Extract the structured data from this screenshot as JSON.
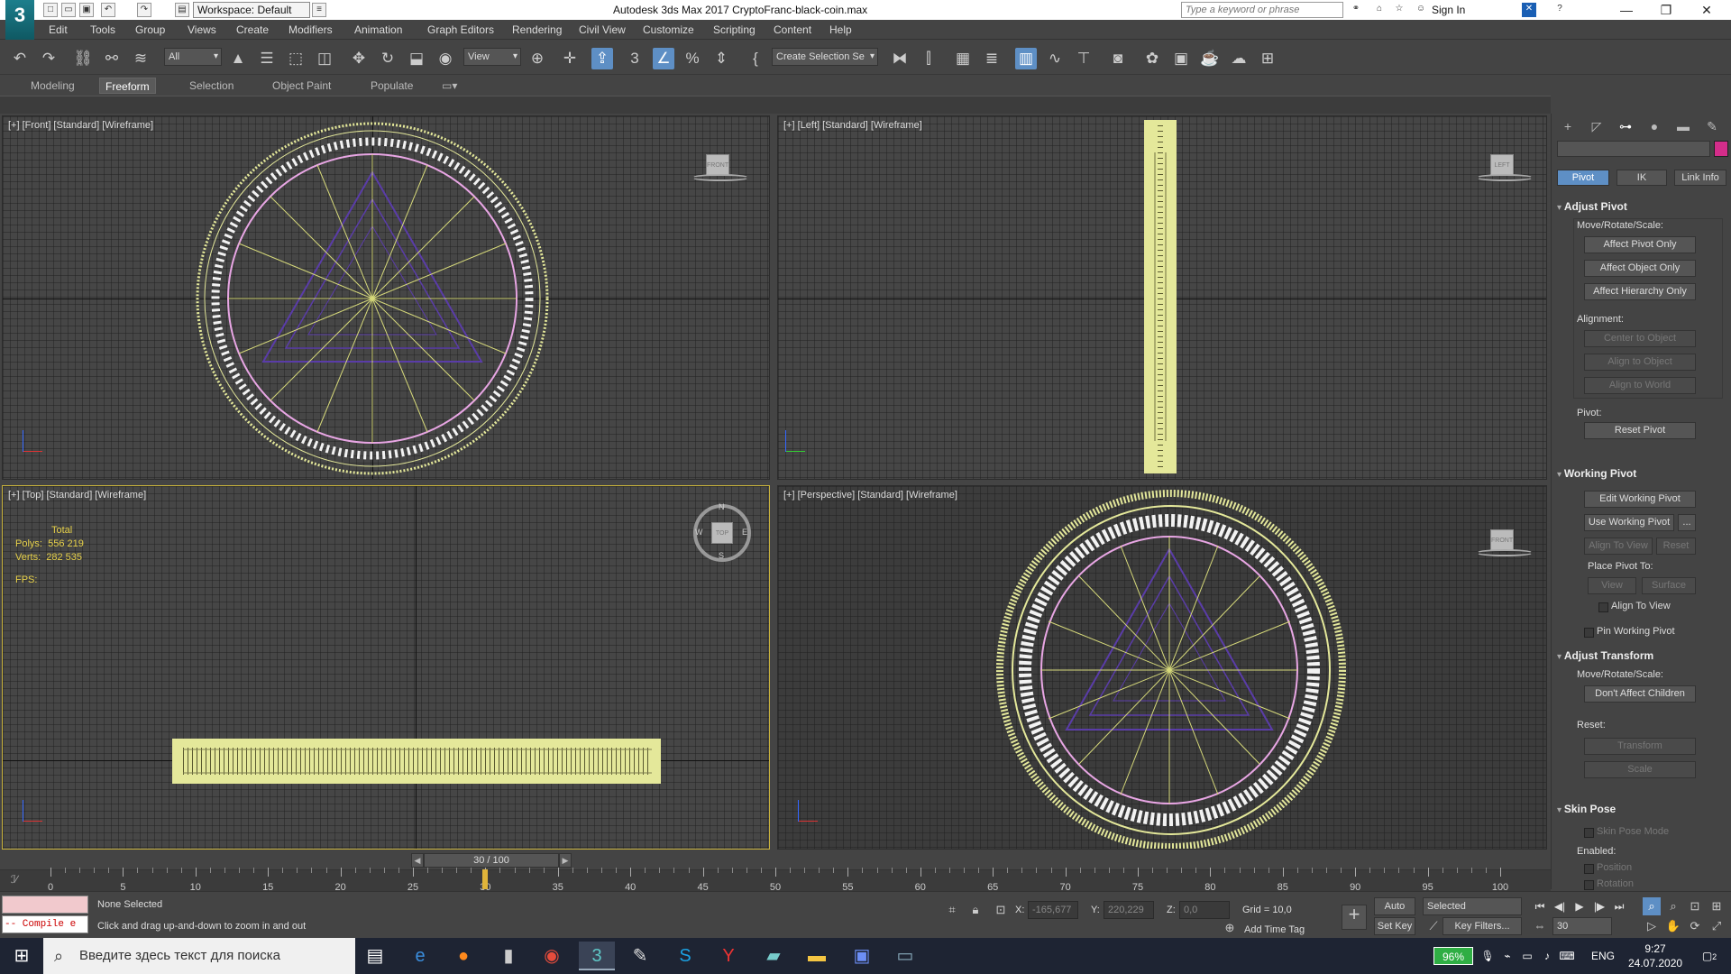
{
  "titlebar": {
    "logo": "3",
    "workspace": "Workspace: Default",
    "title": "Autodesk 3ds Max 2017    CryptoFranc-black-coin.max",
    "search_placeholder": "Type a keyword or phrase",
    "signin": "Sign In"
  },
  "menu": [
    "Edit",
    "Tools",
    "Group",
    "Views",
    "Create",
    "Modifiers",
    "Animation",
    "Graph Editors",
    "Rendering",
    "Civil View",
    "Customize",
    "Scripting",
    "Content",
    "Help"
  ],
  "toolbar": {
    "filter_value": "All",
    "ref_coord_value": "View",
    "selection_set_value": "Create Selection Se"
  },
  "ribbon": {
    "tabs": [
      "Modeling",
      "Freeform",
      "Selection",
      "Object Paint",
      "Populate"
    ],
    "active_tab": "Freeform"
  },
  "viewports": {
    "front": {
      "label": "[+] [Front] [Standard] [Wireframe]",
      "cube": "FRONT"
    },
    "left": {
      "label": "[+] [Left] [Standard] [Wireframe]",
      "cube": "LEFT"
    },
    "top": {
      "label": "[+] [Top] [Standard] [Wireframe]",
      "cube": "TOP",
      "compass": {
        "n": "N",
        "s": "S",
        "e": "E",
        "w": "W"
      },
      "stats": {
        "header": "Total",
        "polys_label": "Polys:",
        "polys": "556 219",
        "verts_label": "Verts:",
        "verts": "282 535",
        "fps_label": "FPS:"
      }
    },
    "perspective": {
      "label": "[+] [Perspective] [Standard] [Wireframe]",
      "cube": "FRONT"
    }
  },
  "command_panel": {
    "subtabs": [
      "Pivot",
      "IK",
      "Link Info"
    ],
    "active_subtab": "Pivot",
    "adjust_pivot": {
      "title": "Adjust Pivot",
      "move_label": "Move/Rotate/Scale:",
      "affect_pivot_only": "Affect Pivot Only",
      "affect_object_only": "Affect Object Only",
      "affect_hierarchy_only": "Affect Hierarchy Only",
      "alignment_label": "Alignment:",
      "center_to_object": "Center to Object",
      "align_to_object": "Align to Object",
      "align_to_world": "Align to World",
      "pivot_label": "Pivot:",
      "reset_pivot": "Reset Pivot"
    },
    "working_pivot": {
      "title": "Working Pivot",
      "edit_working_pivot": "Edit Working Pivot",
      "use_working_pivot": "Use Working Pivot",
      "more": "...",
      "align_to_view": "Align To View",
      "reset": "Reset",
      "place_label": "Place Pivot To:",
      "view": "View",
      "surface": "Surface",
      "align_to_view_check": "Align To View",
      "pin_working_pivot": "Pin Working Pivot"
    },
    "adjust_transform": {
      "title": "Adjust Transform",
      "move_label": "Move/Rotate/Scale:",
      "dont_affect_children": "Don't Affect Children",
      "reset_label": "Reset:",
      "transform": "Transform",
      "scale": "Scale"
    },
    "skin_pose": {
      "title": "Skin Pose",
      "skin_pose_mode": "Skin Pose Mode",
      "enabled_label": "Enabled:",
      "position": "Position",
      "rotation": "Rotation"
    }
  },
  "timeline": {
    "slider_text": "30 / 100",
    "current_frame": 30,
    "total_frames": 100,
    "tick_labels": [
      "0",
      "5",
      "10",
      "15",
      "20",
      "25",
      "30",
      "35",
      "40",
      "45",
      "50",
      "55",
      "60",
      "65",
      "70",
      "75",
      "80",
      "85",
      "90",
      "95",
      "100"
    ]
  },
  "status": {
    "compile_text": "-- Compile e",
    "selection": "None Selected",
    "prompt": "Click and drag up-and-down to zoom in and out",
    "x_label": "X:",
    "x": "-165,677",
    "y_label": "Y:",
    "y": "220,229",
    "z_label": "Z:",
    "z": "0,0",
    "grid": "Grid = 10,0",
    "add_time_tag": "Add Time Tag",
    "auto_key": "Auto Key",
    "set_key": "Set Key",
    "selected": "Selected",
    "key_filters": "Key Filters...",
    "frame_field": "30"
  },
  "taskbar": {
    "search_placeholder": "Введите здесь текст для поиска",
    "battery": "96%",
    "lang": "ENG",
    "time": "9:27",
    "date": "24.07.2020",
    "notifications": "2"
  }
}
